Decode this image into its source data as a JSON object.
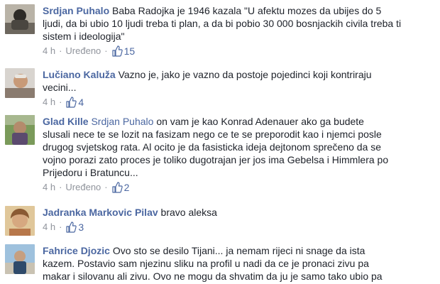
{
  "comments": [
    {
      "author": "Srdjan Puhalo",
      "mention": "",
      "text": "Baba Radojka je 1946 kazala \"U afektu mozes da ubijes do 5\nljudi, da bi ubio 10 ljudi treba ti plan, a da bi pobio 30 000 bosnjackih civila treba ti\nsistem i ideologija\"",
      "time": "4 h",
      "edited": "Uređeno",
      "likes": "15"
    },
    {
      "author": "Lučiano Kaluža",
      "mention": "",
      "text": "Vazno je, jako je vazno da postoje pojedinci koji kontriraju\nvecini...",
      "time": "4 h",
      "edited": "",
      "likes": "4"
    },
    {
      "author": "Glad Kille",
      "mention": "Srdjan Puhalo",
      "text": "on vam je kao Konrad Adenauer ako ga budete\nslusali nece te se lozit na fasizam nego ce te se preporodit kao i njemci posle\ndrugog svjetskog rata. Al ocito je da fasisticka ideja dejtonom sprečeno da se\nvojno porazi zato proces je toliko dugotrajan jer jos ima Gebelsa i Himmlera po\nPrijedoru i Bratuncu...",
      "time": "4 h",
      "edited": "Uređeno",
      "likes": "2"
    },
    {
      "author": "Jadranka Markovic Pilav",
      "mention": "",
      "text": "bravo aleksa",
      "time": "4 h",
      "edited": "",
      "likes": "3"
    },
    {
      "author": "Fahrice Djozic",
      "mention": "",
      "text": "Ovo sto se desilo Tijani... ja nemam rijeci ni snage da ista\nkazem. Postavio sam njezinu sliku na profil u nadi da ce je pronaci zivu pa\nmakar i silovanu ali zivu. Ovo ne mogu da shvatim da ju je samo tako ubio pa",
      "time": "",
      "edited": "",
      "likes": ""
    }
  ],
  "icons": {
    "like": "thumbs-up-icon"
  },
  "colors": {
    "link": "#4b67a1",
    "meta": "#90949c",
    "text": "#1d2129"
  }
}
